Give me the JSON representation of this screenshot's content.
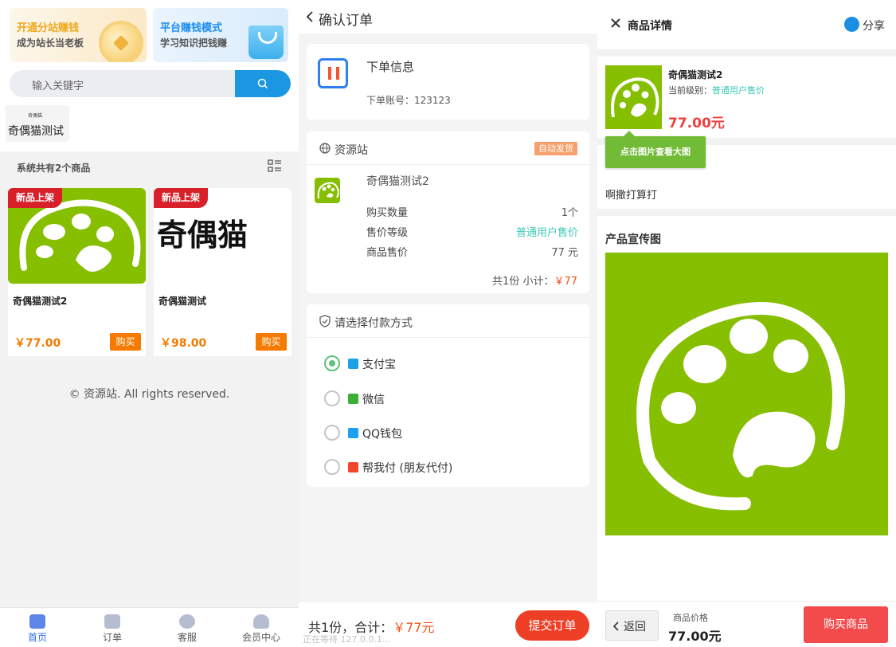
{
  "home": {
    "banners": [
      {
        "title": "开通分站赚钱",
        "subtitle": "成为站长当老板",
        "color": "#f0a81e"
      },
      {
        "title": "平台赚钱模式",
        "subtitle": "学习知识把钱赚",
        "color": "#1e8ef0"
      }
    ],
    "search": {
      "placeholder": "输入关键字",
      "icon": "search-icon"
    },
    "category": {
      "label": "奇偶猫测试",
      "mini_logo": "奇偶猫"
    },
    "count_text": "系统共有2个商品",
    "products": [
      {
        "tag": "新品上架",
        "name": "奇偶猫测试2",
        "price": "￥77.00",
        "buy": "购买"
      },
      {
        "tag": "新品上架",
        "name": "奇偶猫测试",
        "price": "￥98.00",
        "buy": "购买",
        "brand_text": "奇偶猫"
      }
    ],
    "copyright": "© 资源站. All rights reserved.",
    "tabs": [
      {
        "label": "首页",
        "icon": "home-icon",
        "active": true
      },
      {
        "label": "订单",
        "icon": "order-icon",
        "active": false
      },
      {
        "label": "客服",
        "icon": "headset-icon",
        "active": false
      },
      {
        "label": "会员中心",
        "icon": "user-icon",
        "active": false
      }
    ]
  },
  "order": {
    "title": "确认订单",
    "order_info": {
      "label": "下单信息",
      "account": "下单账号：123123"
    },
    "shop": {
      "name": "资源站",
      "badge": "自动发货"
    },
    "item": {
      "name": "奇偶猫测试2",
      "rows": [
        {
          "label": "购买数量",
          "value": "1个"
        },
        {
          "label": "售价等级",
          "value": "普通用户售价"
        },
        {
          "label": "商品售价",
          "value": "77 元"
        }
      ],
      "subtotal_label": "共1份 小计：",
      "subtotal_value": "￥77"
    },
    "payment": {
      "title": "请选择付款方式",
      "methods": [
        {
          "label": "支付宝",
          "selected": true,
          "color": "#1aa1e8"
        },
        {
          "label": "微信",
          "selected": false,
          "color": "#3cb034"
        },
        {
          "label": "QQ钱包",
          "selected": false,
          "color": "#1ea0f0"
        },
        {
          "label": "帮我付 (朋友代付)",
          "selected": false,
          "color": "#f2452d"
        }
      ]
    },
    "footer": {
      "total_label": "共1份，合计：",
      "total_value": "￥77元",
      "status": "正在等待 127.0.0.1...",
      "submit": "提交订单"
    }
  },
  "detail": {
    "title": "商品详情",
    "share": "分享",
    "product": {
      "name": "奇偶猫测试2",
      "level_label": "当前级别：",
      "level_value": "普通用户售价",
      "price": "77.00元"
    },
    "tip": "点击图片查看大图",
    "description": "啊撒打算打",
    "promo_title": "产品宣传图",
    "footer": {
      "back": "返回",
      "price_label": "商品价格",
      "price_value": "77.00元",
      "buy": "购买商品"
    }
  },
  "colors": {
    "accent_blue": "#1a97e0",
    "orange": "#f57a00",
    "brand_green": "#86be00",
    "red": "#ee3f26"
  }
}
